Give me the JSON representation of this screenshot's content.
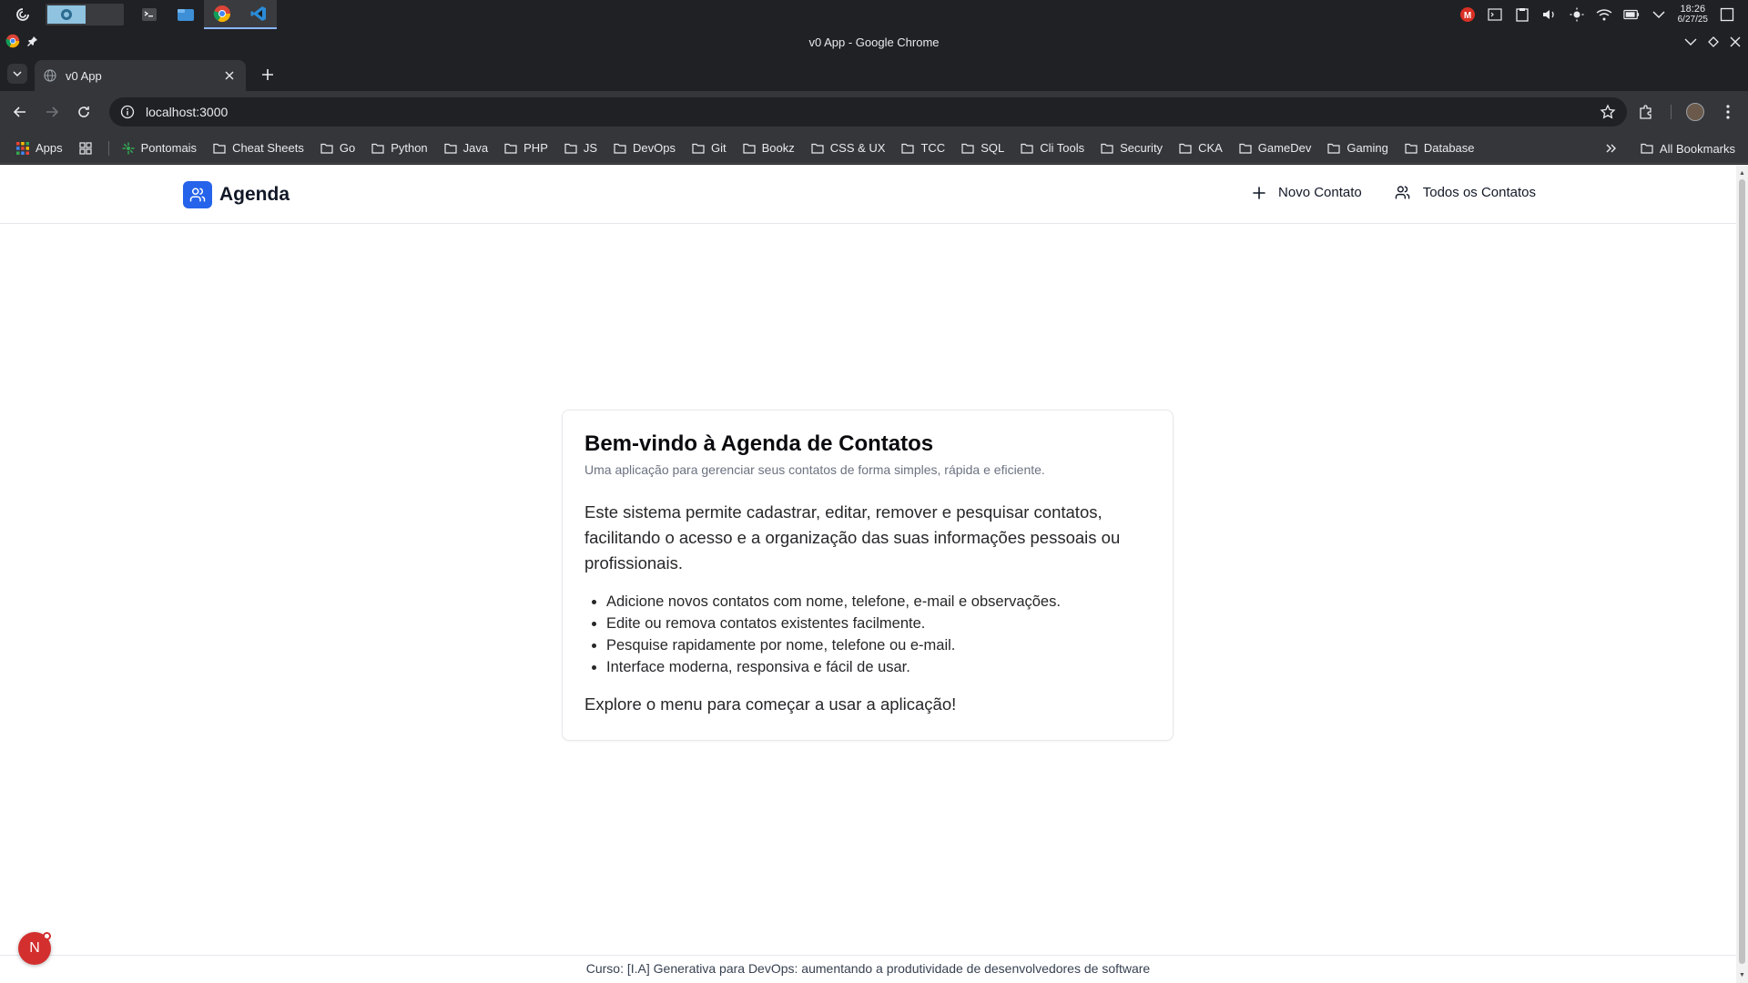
{
  "taskbar": {
    "time": "18:26",
    "date": "6/27/25",
    "apps": [
      "terminal-icon",
      "files-icon",
      "chrome-icon",
      "vscode-icon"
    ],
    "tray_icons": [
      "gmail-icon",
      "console-icon",
      "clipboard-icon",
      "volume-icon",
      "brightness-icon",
      "wifi-icon",
      "battery-icon",
      "chevron-down-icon",
      "notifications-icon"
    ]
  },
  "window": {
    "title": "v0 App - Google Chrome"
  },
  "tabs": [
    {
      "label": "v0 App",
      "active": true
    }
  ],
  "toolbar": {
    "url": "localhost:3000"
  },
  "bookmarks": {
    "items": [
      {
        "label": "Apps",
        "icon": "apps-grid-icon"
      },
      {
        "label": "Pontomais",
        "icon": "pontomais-icon"
      },
      {
        "label": "Cheat Sheets",
        "icon": "folder-icon"
      },
      {
        "label": "Go",
        "icon": "folder-icon"
      },
      {
        "label": "Python",
        "icon": "folder-icon"
      },
      {
        "label": "Java",
        "icon": "folder-icon"
      },
      {
        "label": "PHP",
        "icon": "folder-icon"
      },
      {
        "label": "JS",
        "icon": "folder-icon"
      },
      {
        "label": "DevOps",
        "icon": "folder-icon"
      },
      {
        "label": "Git",
        "icon": "folder-icon"
      },
      {
        "label": "Bookz",
        "icon": "folder-icon"
      },
      {
        "label": "CSS & UX",
        "icon": "folder-icon"
      },
      {
        "label": "TCC",
        "icon": "folder-icon"
      },
      {
        "label": "SQL",
        "icon": "folder-icon"
      },
      {
        "label": "Cli Tools",
        "icon": "folder-icon"
      },
      {
        "label": "Security",
        "icon": "folder-icon"
      },
      {
        "label": "CKA",
        "icon": "folder-icon"
      },
      {
        "label": "GameDev",
        "icon": "folder-icon"
      },
      {
        "label": "Gaming",
        "icon": "folder-icon"
      },
      {
        "label": "Database",
        "icon": "folder-icon"
      }
    ],
    "all_bookmarks": "All Bookmarks"
  },
  "app": {
    "brand": "Agenda",
    "accent_color": "#2563eb",
    "nav": {
      "new_contact": "Novo Contato",
      "all_contacts": "Todos os Contatos"
    },
    "card": {
      "title": "Bem-vindo à Agenda de Contatos",
      "subtitle": "Uma aplicação para gerenciar seus contatos de forma simples, rápida e eficiente.",
      "description": "Este sistema permite cadastrar, editar, remover e pesquisar contatos, facilitando o acesso e a organização das suas informações pessoais ou profissionais.",
      "features": [
        "Adicione novos contatos com nome, telefone, e-mail e observações.",
        "Edite ou remova contatos existentes facilmente.",
        "Pesquise rapidamente por nome, telefone ou e-mail.",
        "Interface moderna, responsiva e fácil de usar."
      ],
      "cta": "Explore o menu para começar a usar a aplicação!"
    },
    "footer": "Curso: [I.A] Generativa para DevOps: aumentando a produtividade de desenvolvedores de software",
    "floating_badge": "N"
  }
}
